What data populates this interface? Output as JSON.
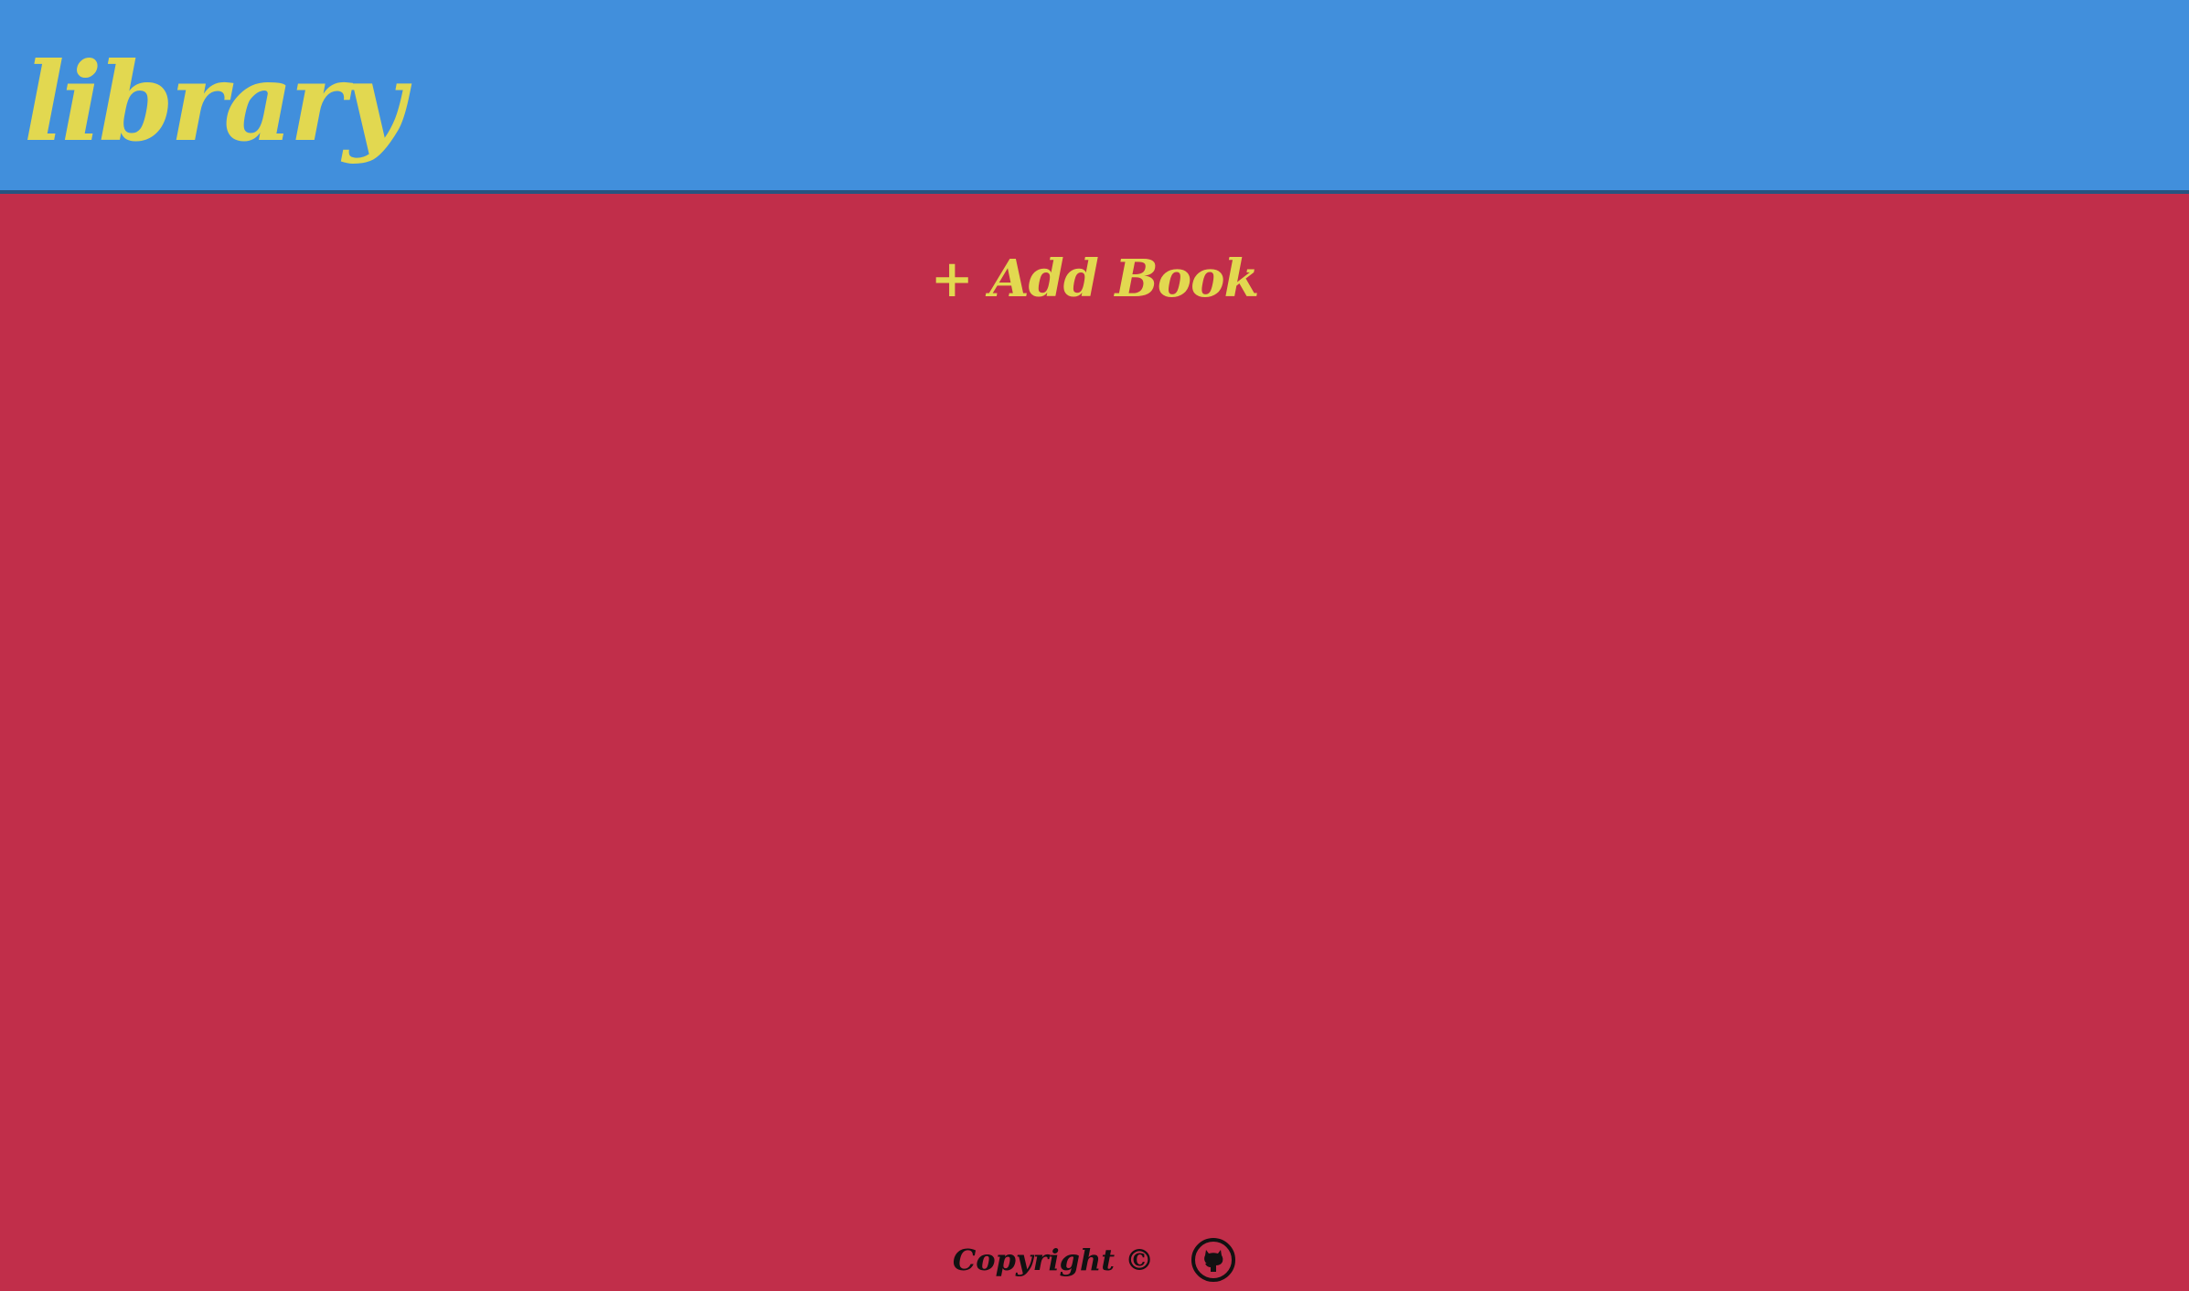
{
  "header": {
    "title": "library"
  },
  "main": {
    "add_book_label": "+ Add Book"
  },
  "footer": {
    "copyright": "Copyright ©",
    "github_icon": "github-icon"
  },
  "colors": {
    "header_bg": "#418fdc",
    "body_bg": "#c12e4a",
    "accent": "#e2d850",
    "header_border": "#275480"
  }
}
